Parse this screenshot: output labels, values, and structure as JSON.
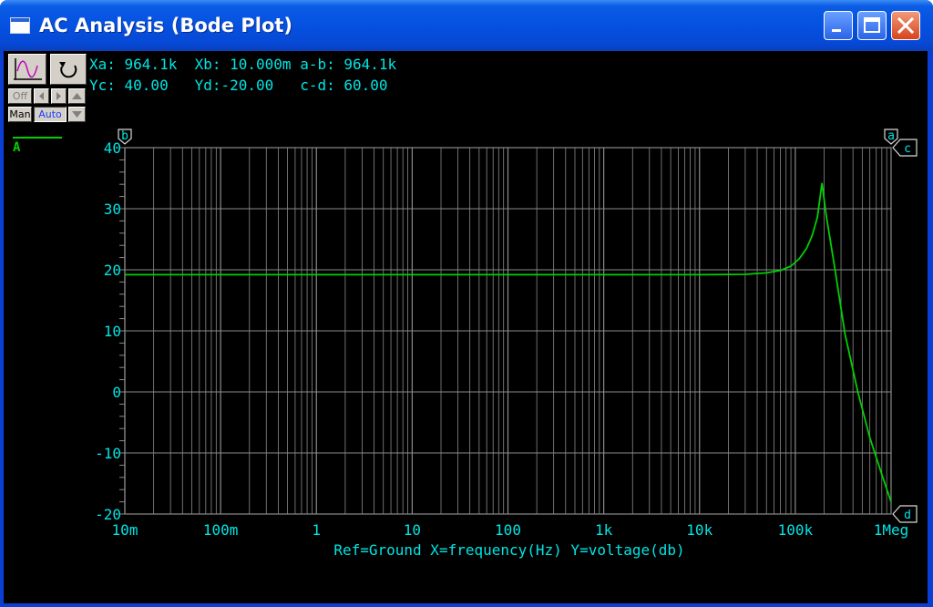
{
  "window": {
    "title": "AC Analysis (Bode Plot)"
  },
  "toolbar": {
    "off_label": "Off",
    "man_label": "Man",
    "auto_label": "Auto"
  },
  "readouts": {
    "row1": "Xa: 964.1k  Xb: 10.000m a-b: 964.1k",
    "row2": "Yc: 40.00   Yd:-20.00   c-d: 60.00"
  },
  "legend": {
    "label": "A",
    "color": "#00d000"
  },
  "cursors": {
    "b": "b",
    "a": "a",
    "c": "c",
    "d": "d"
  },
  "footer": "Ref=Ground  X=frequency(Hz) Y=voltage(db)",
  "colors": {
    "trace": "#00d000",
    "axis_text": "#00e5e5",
    "grid": "#8a8a8a",
    "background": "#000000"
  },
  "chart_data": {
    "type": "line",
    "x_scale": "log",
    "xlabel": "frequency(Hz)",
    "ylabel": "voltage(db)",
    "xlim": [
      0.01,
      1000000
    ],
    "ylim": [
      -20,
      40
    ],
    "x_tick_values": [
      0.01,
      0.1,
      1,
      10,
      100,
      1000,
      10000,
      100000,
      1000000
    ],
    "x_tick_labels": [
      "10m",
      "100m",
      "1",
      "10",
      "100",
      "1k",
      "10k",
      "100k",
      "1Meg"
    ],
    "y_tick_values": [
      40,
      30,
      20,
      10,
      0,
      -10,
      -20
    ],
    "y_tick_labels": [
      "40",
      "30",
      "20",
      "10",
      "0",
      "-10",
      "-20"
    ],
    "grid": true,
    "series": [
      {
        "name": "A",
        "color": "#00d000",
        "x": [
          0.01,
          1,
          100,
          10000,
          30000,
          50000,
          70000,
          90000,
          110000,
          130000,
          150000,
          170000,
          190000,
          210000,
          260000,
          330000,
          450000,
          600000,
          800000,
          1000000
        ],
        "y": [
          19.2,
          19.2,
          19.2,
          19.2,
          19.25,
          19.5,
          19.9,
          20.6,
          21.8,
          23.4,
          25.6,
          28.6,
          34.2,
          29.0,
          20.0,
          9.5,
          0.0,
          -7.5,
          -13.5,
          -18.0
        ]
      }
    ]
  }
}
